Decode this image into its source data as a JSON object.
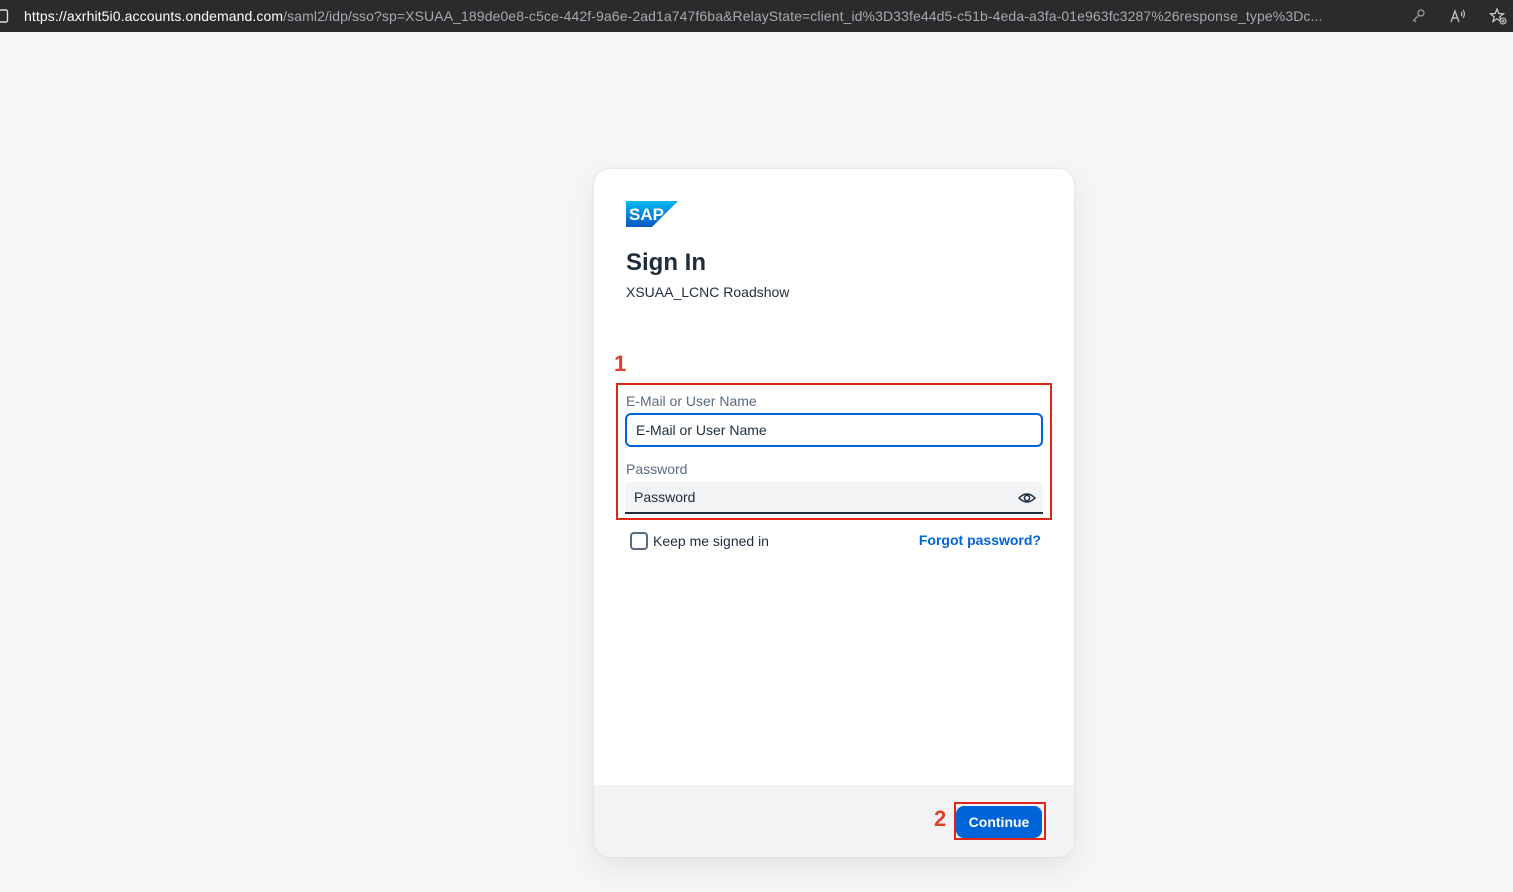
{
  "browser": {
    "url_host": "https://axrhit5i0.accounts.ondemand.com",
    "url_path": "/saml2/idp/sso?sp=XSUAA_189de0e8-c5ce-442f-9a6e-2ad1a747f6ba&RelayState=client_id%3D33fe44d5-c51b-4eda-a3fa-01e963fc3287%26response_type%3Dc..."
  },
  "logo": {
    "text": "SAP",
    "color": "#0a6ed1"
  },
  "signin": {
    "title": "Sign In",
    "subtitle": "XSUAA_LCNC Roadshow",
    "email_label": "E-Mail or User Name",
    "email_placeholder": "E-Mail or User Name",
    "password_label": "Password",
    "password_placeholder": "Password",
    "keep_signed_in": "Keep me signed in",
    "forgot_password": "Forgot password?",
    "continue": "Continue"
  },
  "annotations": {
    "step1": "1",
    "step2": "2",
    "color": "#e0251b"
  },
  "colors": {
    "primary": "#0064d9",
    "text": "#1d2d3e",
    "label": "#556b82"
  }
}
